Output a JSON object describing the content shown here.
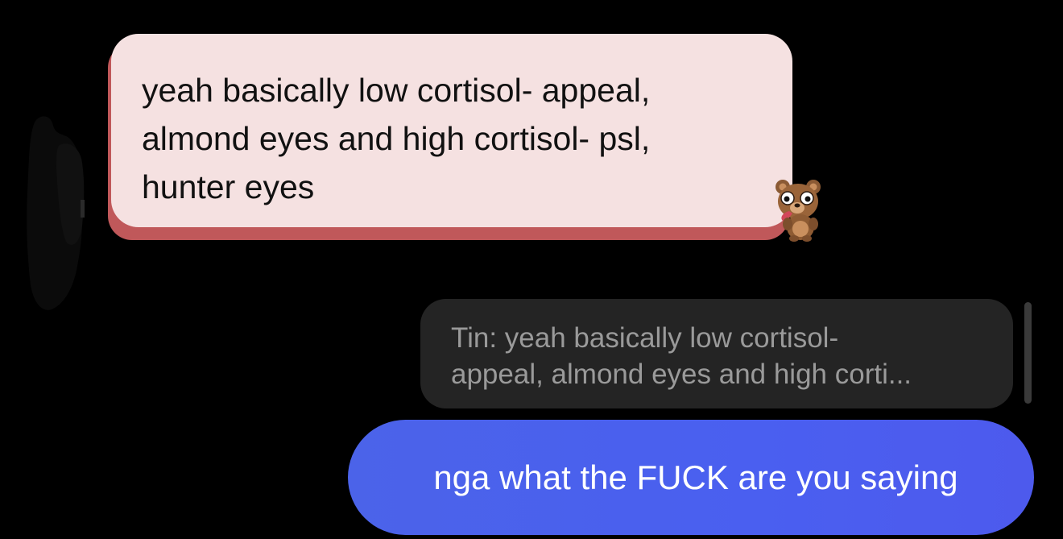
{
  "received_message": {
    "lines": [
      "yeah basically low cortisol- appeal,",
      "almond eyes and high cortisol- psl,",
      "hunter eyes"
    ],
    "bubble_color": "#f5e1e1",
    "accent_color": "#c0585a",
    "reaction_sticker": "bear-sticker-icon"
  },
  "reply_preview": {
    "lines": [
      "Tin: yeah basically low cortisol-",
      "appeal, almond eyes and high corti..."
    ],
    "bubble_color": "#242424"
  },
  "sent_message": {
    "text": "nga what the FUCK are you saying",
    "bubble_color": "#4a5ff0"
  },
  "avatar": {
    "state": "redacted"
  }
}
